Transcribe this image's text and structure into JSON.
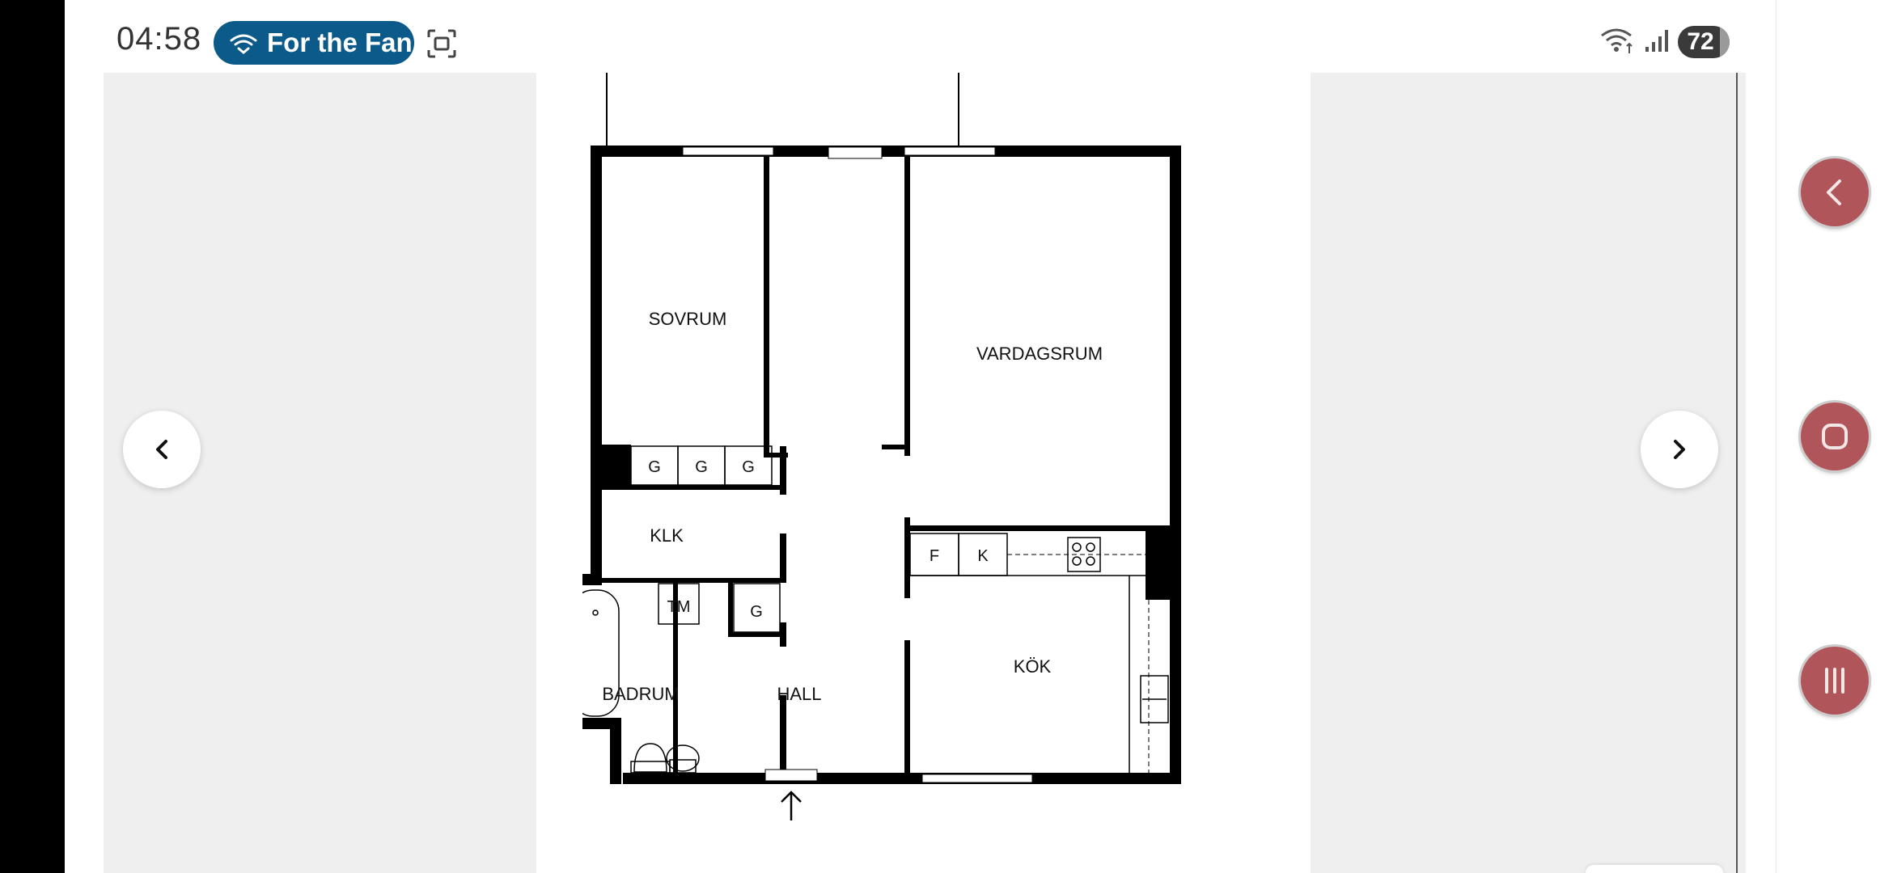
{
  "status_bar": {
    "time": "04:58",
    "media_pill": {
      "label": "For the Fan",
      "icon": "broadcast-icon",
      "color": "#0b5a8a"
    },
    "screenshot_icon": "screenshot-icon",
    "wifi_icon": "wifi-icon",
    "signal_icon": "signal-icon",
    "battery_level": "72"
  },
  "viewer": {
    "prev_button": {
      "icon": "chevron-left-icon"
    },
    "next_button": {
      "icon": "chevron-right-icon"
    }
  },
  "floorplan": {
    "rooms": {
      "sovrum": "SOVRUM",
      "vardagsrum": "VARDAGSRUM",
      "klk": "KLK",
      "badrum": "BADRUM",
      "hall": "HALL",
      "kok": "KÖK"
    },
    "fixtures": {
      "g1": "G",
      "g2": "G",
      "g3": "G",
      "g4": "G",
      "tm": "TM",
      "f": "F",
      "k": "K"
    },
    "entrance_icon": "arrow-up-icon"
  },
  "system_nav": {
    "back": {
      "icon": "back-icon"
    },
    "home": {
      "icon": "home-icon"
    },
    "recents": {
      "icon": "recents-icon"
    },
    "accent": "#b0555a"
  }
}
